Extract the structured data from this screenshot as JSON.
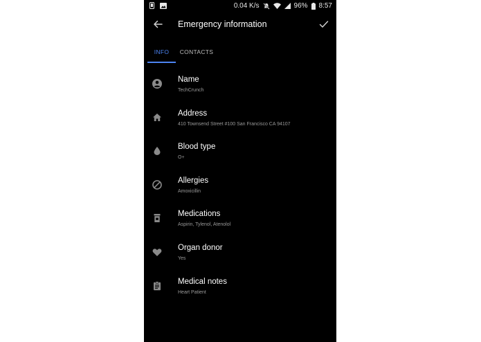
{
  "status_bar": {
    "speed": "0.04 K/s",
    "battery": "96%",
    "time": "8:57"
  },
  "toolbar": {
    "title": "Emergency information"
  },
  "tabs": [
    {
      "label": "INFO",
      "active": true
    },
    {
      "label": "CONTACTS",
      "active": false
    }
  ],
  "colors": {
    "accent": "#4c84f2",
    "background": "#000000",
    "icon": "#8a8a8a"
  },
  "fields": [
    {
      "icon": "account-circle-icon",
      "label": "Name",
      "value": "TechCrunch"
    },
    {
      "icon": "home-icon",
      "label": "Address",
      "value": "410 Townsend Street #100 San Francisco CA 94107"
    },
    {
      "icon": "blood-drop-icon",
      "label": "Blood type",
      "value": "O+"
    },
    {
      "icon": "block-icon",
      "label": "Allergies",
      "value": "Amoxicillin"
    },
    {
      "icon": "pill-bottle-icon",
      "label": "Medications",
      "value": "Aspirin, Tylenol, Atenolol"
    },
    {
      "icon": "heart-icon",
      "label": "Organ donor",
      "value": "Yes"
    },
    {
      "icon": "clipboard-icon",
      "label": "Medical notes",
      "value": "Heart Patient"
    }
  ]
}
